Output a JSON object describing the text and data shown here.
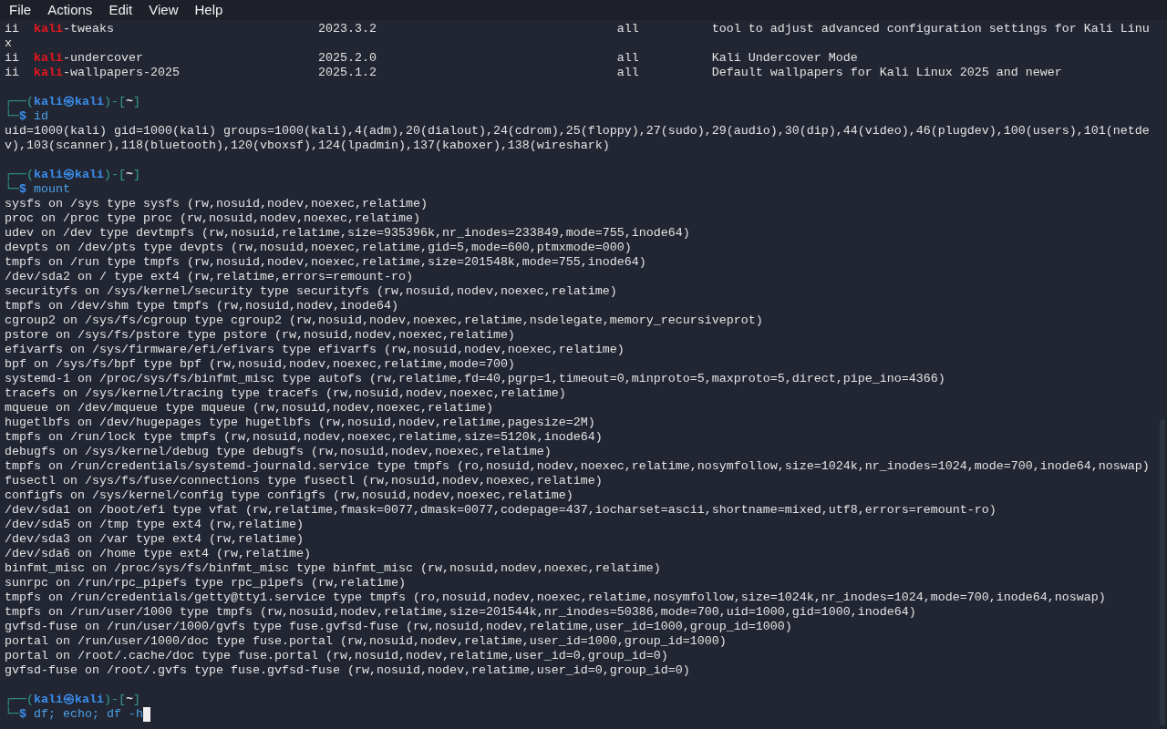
{
  "menu": [
    {
      "label": "File"
    },
    {
      "label": "Actions"
    },
    {
      "label": "Edit"
    },
    {
      "label": "View"
    },
    {
      "label": "Help"
    }
  ],
  "lines": [
    {
      "kind": "package",
      "status": "ii",
      "highlight": "kali",
      "name": "-tweaks",
      "version": "2023.3.2",
      "arch": "all",
      "description": "tool to adjust advanced configuration settings for Kali Linu"
    },
    {
      "kind": "text",
      "text": "x"
    },
    {
      "kind": "package",
      "status": "ii",
      "highlight": "kali",
      "name": "-undercover",
      "version": "2025.2.0",
      "arch": "all",
      "description": "Kali Undercover Mode"
    },
    {
      "kind": "package",
      "status": "ii",
      "highlight": "kali",
      "name": "-wallpapers-2025",
      "version": "2025.1.2",
      "arch": "all",
      "description": "Default wallpapers for Kali Linux 2025 and newer"
    },
    {
      "kind": "blank"
    },
    {
      "kind": "prompt",
      "lead": "┌──(",
      "user": "kali",
      "at": "㉿",
      "host": "kali",
      "mid": ")-[",
      "dir": "~",
      "close": "]",
      "lead2": "└─",
      "sigil": "$",
      "command": "id",
      "cursor": false
    },
    {
      "kind": "text",
      "text": "uid=1000(kali) gid=1000(kali) groups=1000(kali),4(adm),20(dialout),24(cdrom),25(floppy),27(sudo),29(audio),30(dip),44(video),46(plugdev),100(users),101(netde"
    },
    {
      "kind": "text",
      "text": "v),103(scanner),118(bluetooth),120(vboxsf),124(lpadmin),137(kaboxer),138(wireshark)"
    },
    {
      "kind": "blank"
    },
    {
      "kind": "prompt",
      "lead": "┌──(",
      "user": "kali",
      "at": "㉿",
      "host": "kali",
      "mid": ")-[",
      "dir": "~",
      "close": "]",
      "lead2": "└─",
      "sigil": "$",
      "command": "mount",
      "cursor": false
    },
    {
      "kind": "text",
      "text": "sysfs on /sys type sysfs (rw,nosuid,nodev,noexec,relatime)"
    },
    {
      "kind": "text",
      "text": "proc on /proc type proc (rw,nosuid,nodev,noexec,relatime)"
    },
    {
      "kind": "text",
      "text": "udev on /dev type devtmpfs (rw,nosuid,relatime,size=935396k,nr_inodes=233849,mode=755,inode64)"
    },
    {
      "kind": "text",
      "text": "devpts on /dev/pts type devpts (rw,nosuid,noexec,relatime,gid=5,mode=600,ptmxmode=000)"
    },
    {
      "kind": "text",
      "text": "tmpfs on /run type tmpfs (rw,nosuid,nodev,noexec,relatime,size=201548k,mode=755,inode64)"
    },
    {
      "kind": "text",
      "text": "/dev/sda2 on / type ext4 (rw,relatime,errors=remount-ro)"
    },
    {
      "kind": "text",
      "text": "securityfs on /sys/kernel/security type securityfs (rw,nosuid,nodev,noexec,relatime)"
    },
    {
      "kind": "text",
      "text": "tmpfs on /dev/shm type tmpfs (rw,nosuid,nodev,inode64)"
    },
    {
      "kind": "text",
      "text": "cgroup2 on /sys/fs/cgroup type cgroup2 (rw,nosuid,nodev,noexec,relatime,nsdelegate,memory_recursiveprot)"
    },
    {
      "kind": "text",
      "text": "pstore on /sys/fs/pstore type pstore (rw,nosuid,nodev,noexec,relatime)"
    },
    {
      "kind": "text",
      "text": "efivarfs on /sys/firmware/efi/efivars type efivarfs (rw,nosuid,nodev,noexec,relatime)"
    },
    {
      "kind": "text",
      "text": "bpf on /sys/fs/bpf type bpf (rw,nosuid,nodev,noexec,relatime,mode=700)"
    },
    {
      "kind": "text",
      "text": "systemd-1 on /proc/sys/fs/binfmt_misc type autofs (rw,relatime,fd=40,pgrp=1,timeout=0,minproto=5,maxproto=5,direct,pipe_ino=4366)"
    },
    {
      "kind": "text",
      "text": "tracefs on /sys/kernel/tracing type tracefs (rw,nosuid,nodev,noexec,relatime)"
    },
    {
      "kind": "text",
      "text": "mqueue on /dev/mqueue type mqueue (rw,nosuid,nodev,noexec,relatime)"
    },
    {
      "kind": "text",
      "text": "hugetlbfs on /dev/hugepages type hugetlbfs (rw,nosuid,nodev,relatime,pagesize=2M)"
    },
    {
      "kind": "text",
      "text": "tmpfs on /run/lock type tmpfs (rw,nosuid,nodev,noexec,relatime,size=5120k,inode64)"
    },
    {
      "kind": "text",
      "text": "debugfs on /sys/kernel/debug type debugfs (rw,nosuid,nodev,noexec,relatime)"
    },
    {
      "kind": "text",
      "text": "tmpfs on /run/credentials/systemd-journald.service type tmpfs (ro,nosuid,nodev,noexec,relatime,nosymfollow,size=1024k,nr_inodes=1024,mode=700,inode64,noswap)"
    },
    {
      "kind": "text",
      "text": "fusectl on /sys/fs/fuse/connections type fusectl (rw,nosuid,nodev,noexec,relatime)"
    },
    {
      "kind": "text",
      "text": "configfs on /sys/kernel/config type configfs (rw,nosuid,nodev,noexec,relatime)"
    },
    {
      "kind": "text",
      "text": "/dev/sda1 on /boot/efi type vfat (rw,relatime,fmask=0077,dmask=0077,codepage=437,iocharset=ascii,shortname=mixed,utf8,errors=remount-ro)"
    },
    {
      "kind": "text",
      "text": "/dev/sda5 on /tmp type ext4 (rw,relatime)"
    },
    {
      "kind": "text",
      "text": "/dev/sda3 on /var type ext4 (rw,relatime)"
    },
    {
      "kind": "text",
      "text": "/dev/sda6 on /home type ext4 (rw,relatime)"
    },
    {
      "kind": "text",
      "text": "binfmt_misc on /proc/sys/fs/binfmt_misc type binfmt_misc (rw,nosuid,nodev,noexec,relatime)"
    },
    {
      "kind": "text",
      "text": "sunrpc on /run/rpc_pipefs type rpc_pipefs (rw,relatime)"
    },
    {
      "kind": "text",
      "text": "tmpfs on /run/credentials/getty@tty1.service type tmpfs (ro,nosuid,nodev,noexec,relatime,nosymfollow,size=1024k,nr_inodes=1024,mode=700,inode64,noswap)"
    },
    {
      "kind": "text",
      "text": "tmpfs on /run/user/1000 type tmpfs (rw,nosuid,nodev,relatime,size=201544k,nr_inodes=50386,mode=700,uid=1000,gid=1000,inode64)"
    },
    {
      "kind": "text",
      "text": "gvfsd-fuse on /run/user/1000/gvfs type fuse.gvfsd-fuse (rw,nosuid,nodev,relatime,user_id=1000,group_id=1000)"
    },
    {
      "kind": "text",
      "text": "portal on /run/user/1000/doc type fuse.portal (rw,nosuid,nodev,relatime,user_id=1000,group_id=1000)"
    },
    {
      "kind": "text",
      "text": "portal on /root/.cache/doc type fuse.portal (rw,nosuid,nodev,relatime,user_id=0,group_id=0)"
    },
    {
      "kind": "text",
      "text": "gvfsd-fuse on /root/.gvfs type fuse.gvfsd-fuse (rw,nosuid,nodev,relatime,user_id=0,group_id=0)"
    },
    {
      "kind": "blank"
    },
    {
      "kind": "prompt",
      "lead": "┌──(",
      "user": "kali",
      "at": "㉿",
      "host": "kali",
      "mid": ")-[",
      "dir": "~",
      "close": "]",
      "lead2": "└─",
      "sigil": "$",
      "command": "df; echo; df -h",
      "cursor": true
    }
  ]
}
